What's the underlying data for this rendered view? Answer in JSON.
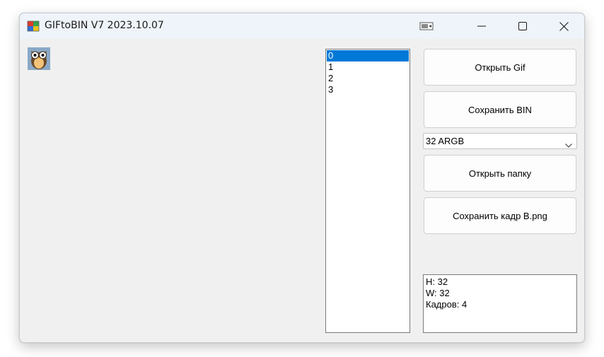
{
  "window": {
    "title": "GIFtoBIN V7 2023.10.07",
    "app_icon": "app-palette-icon",
    "caption_buttons": [
      "minimize-icon",
      "maximize-icon",
      "close-icon"
    ]
  },
  "preview": {
    "icon": "owl-icon"
  },
  "frame_list": {
    "items": [
      "0",
      "1",
      "2",
      "3"
    ],
    "selected_index": 0
  },
  "buttons": {
    "open_gif": "Открыть Gif",
    "save_bin": "Сохранить BIN",
    "open_folder": "Открыть папку",
    "save_frame": "Сохранить кадр В.png"
  },
  "format_select": {
    "value": "32 ARGB"
  },
  "info": {
    "lines": [
      "H: 32",
      "W: 32",
      "Кадров: 4"
    ]
  },
  "colors": {
    "selection": "#0078d7",
    "window_bg": "#f0f0f0",
    "titlebar_bg": "#eef4f9"
  }
}
